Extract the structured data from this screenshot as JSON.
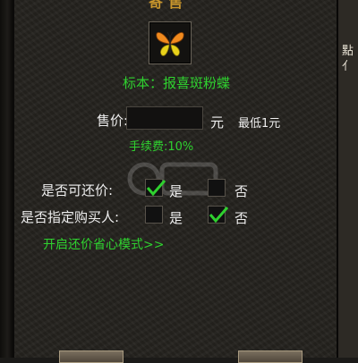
{
  "window": {
    "title": "寄售"
  },
  "item": {
    "icon": "butterfly-icon",
    "specimen_label": "标本：报喜斑粉蝶"
  },
  "price": {
    "label": "售价:",
    "value": "",
    "currency": "元",
    "min_note": "最低1元"
  },
  "fee": {
    "text": "手续费:10%"
  },
  "bargain": {
    "label": "是否可还价:",
    "yes_label": "是",
    "yes_checked": true,
    "no_label": "否",
    "no_checked": false
  },
  "buyer": {
    "label": "是否指定购买人:",
    "yes_label": "是",
    "yes_checked": false,
    "no_label": "否",
    "no_checked": true
  },
  "worry_free_link": "开启还价省心模式>>",
  "colors": {
    "accent_green": "#2fd12f",
    "title_gold": "#c8962c"
  }
}
